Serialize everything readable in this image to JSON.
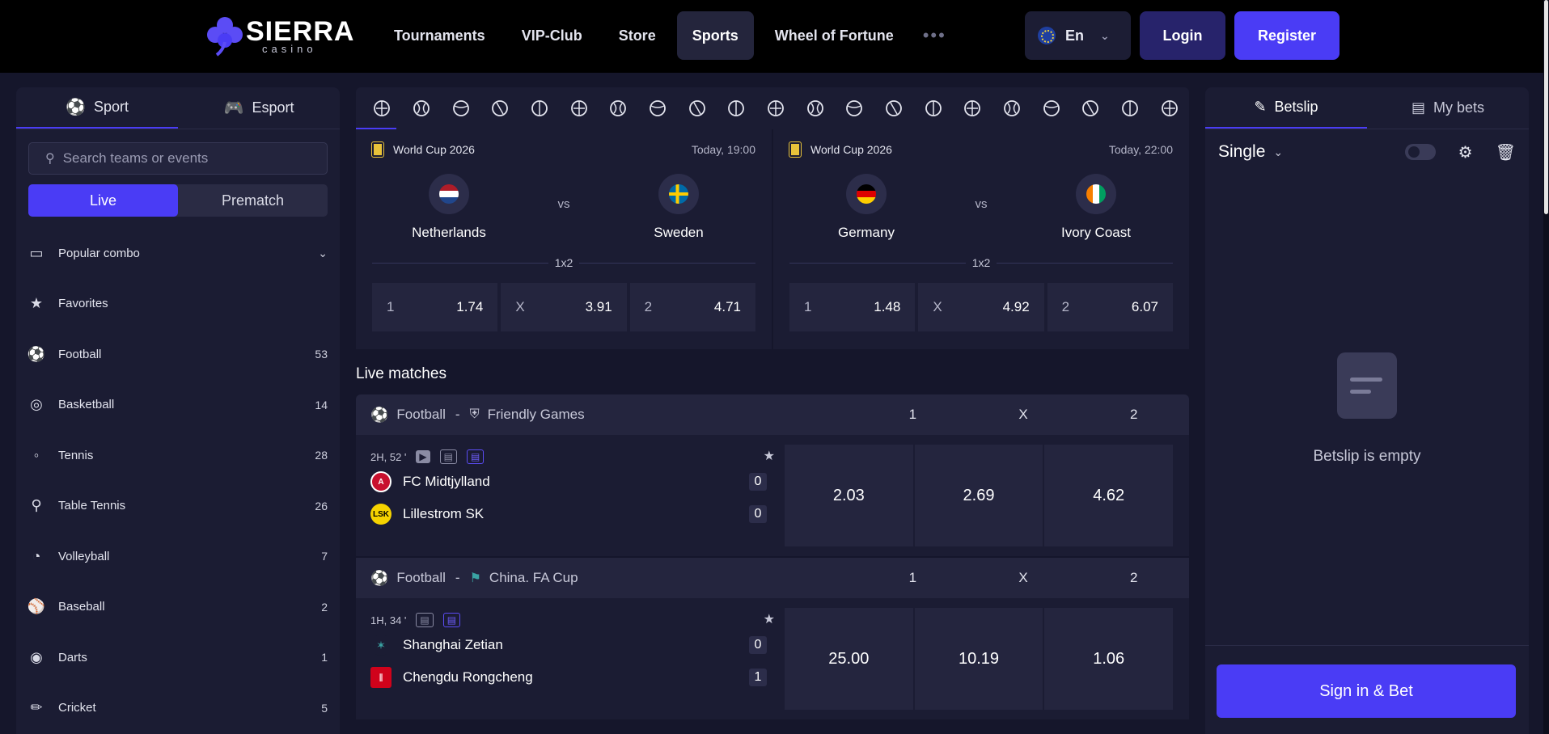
{
  "brand": {
    "name": "SIERRA",
    "sub": "casino"
  },
  "nav": {
    "items": [
      "Tournaments",
      "VIP-Club",
      "Store",
      "Sports",
      "Wheel of Fortune"
    ],
    "more": "•••",
    "language": "En",
    "login": "Login",
    "register": "Register"
  },
  "sidebar": {
    "tabs": {
      "sport": "Sport",
      "esport": "Esport"
    },
    "search_placeholder": "Search teams or events",
    "modes": {
      "live": "Live",
      "prematch": "Prematch"
    },
    "items": [
      {
        "name": "Popular combo",
        "count": "",
        "icon": "ticket-icon"
      },
      {
        "name": "Favorites",
        "count": "",
        "icon": "star-icon"
      },
      {
        "name": "Football",
        "count": "53",
        "icon": "football-icon"
      },
      {
        "name": "Basketball",
        "count": "14",
        "icon": "basketball-icon"
      },
      {
        "name": "Tennis",
        "count": "28",
        "icon": "tennis-icon"
      },
      {
        "name": "Table Tennis",
        "count": "26",
        "icon": "table-tennis-icon"
      },
      {
        "name": "Volleyball",
        "count": "7",
        "icon": "volleyball-icon"
      },
      {
        "name": "Baseball",
        "count": "2",
        "icon": "baseball-icon"
      },
      {
        "name": "Darts",
        "count": "1",
        "icon": "darts-icon"
      },
      {
        "name": "Cricket",
        "count": "5",
        "icon": "cricket-icon"
      }
    ]
  },
  "featured": [
    {
      "league": "World Cup 2026",
      "time": "Today, 19:00",
      "home": "Netherlands",
      "away": "Sweden",
      "vs": "vs",
      "market": "1x2",
      "home_colors": [
        "#ae1c28",
        "#ffffff",
        "#21468b"
      ],
      "away_colors": [
        "#006aa7",
        "#fecc00"
      ],
      "odds": [
        {
          "label": "1",
          "value": "1.74"
        },
        {
          "label": "X",
          "value": "3.91"
        },
        {
          "label": "2",
          "value": "4.71"
        }
      ]
    },
    {
      "league": "World Cup 2026",
      "time": "Today, 22:00",
      "home": "Germany",
      "away": "Ivory Coast",
      "vs": "vs",
      "market": "1x2",
      "home_colors": [
        "#000000",
        "#dd0000",
        "#ffce00"
      ],
      "away_colors": [
        "#f77f00",
        "#ffffff",
        "#009e60"
      ],
      "odds": [
        {
          "label": "1",
          "value": "1.48"
        },
        {
          "label": "X",
          "value": "4.92"
        },
        {
          "label": "2",
          "value": "6.07"
        }
      ]
    }
  ],
  "live": {
    "title": "Live matches",
    "groups": [
      {
        "sport": "Football",
        "sep": "-",
        "league": "Friendly Games",
        "cols": [
          "1",
          "X",
          "2"
        ],
        "match": {
          "clock": "2H, 52 '",
          "home": "FC Midtjylland",
          "home_score": "0",
          "away": "Lillestrom SK",
          "away_score": "0",
          "odds": [
            "2.03",
            "2.69",
            "4.62"
          ]
        }
      },
      {
        "sport": "Football",
        "sep": "-",
        "league": "China. FA Cup",
        "cols": [
          "1",
          "X",
          "2"
        ],
        "match": {
          "clock": "1H, 34 '",
          "home": "Shanghai Zetian",
          "home_score": "0",
          "away": "Chengdu Rongcheng",
          "away_score": "1",
          "odds": [
            "25.00",
            "10.19",
            "1.06"
          ]
        }
      }
    ]
  },
  "betslip": {
    "tabs": {
      "betslip": "Betslip",
      "mybets": "My bets"
    },
    "mode": "Single",
    "empty": "Betslip is empty",
    "sign_in": "Sign in & Bet"
  },
  "colors": {
    "accent": "#4a3cf5",
    "panel": "#1b1c33",
    "bg": "#15162b"
  }
}
